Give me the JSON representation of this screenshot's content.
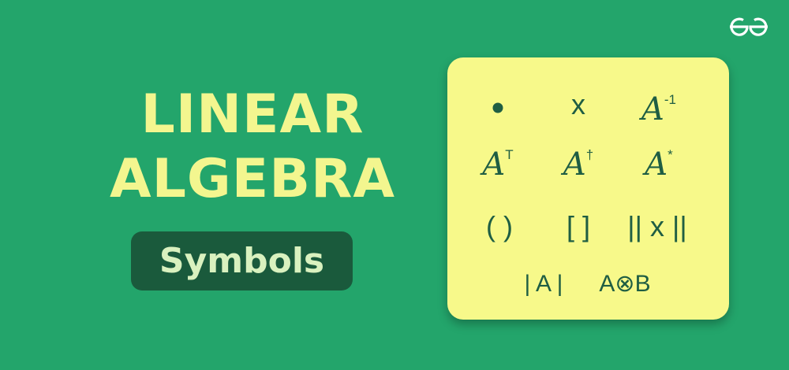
{
  "title": {
    "line1": "LINEAR",
    "line2": "ALGEBRA"
  },
  "subtitle": "Symbols",
  "logo": {
    "name": "geeksforgeeks-logo",
    "color": "#ffffff"
  },
  "colors": {
    "background": "#23a56b",
    "title": "#f3f68f",
    "pill": "#1a5a3c",
    "card": "#f7f98a",
    "symbol": "#1f5e43"
  },
  "symbols": {
    "dot": "•",
    "cross": "x",
    "inverse": {
      "base": "A",
      "sup": "-1"
    },
    "transpose": {
      "base": "A",
      "sup": "T"
    },
    "dagger": {
      "base": "A",
      "sup": "†"
    },
    "star": {
      "base": "A",
      "sup": "*"
    },
    "parens": "( )",
    "brackets": "[ ]",
    "norm": "|| x ||",
    "det": "| A |",
    "tensor": "A⊗B"
  }
}
